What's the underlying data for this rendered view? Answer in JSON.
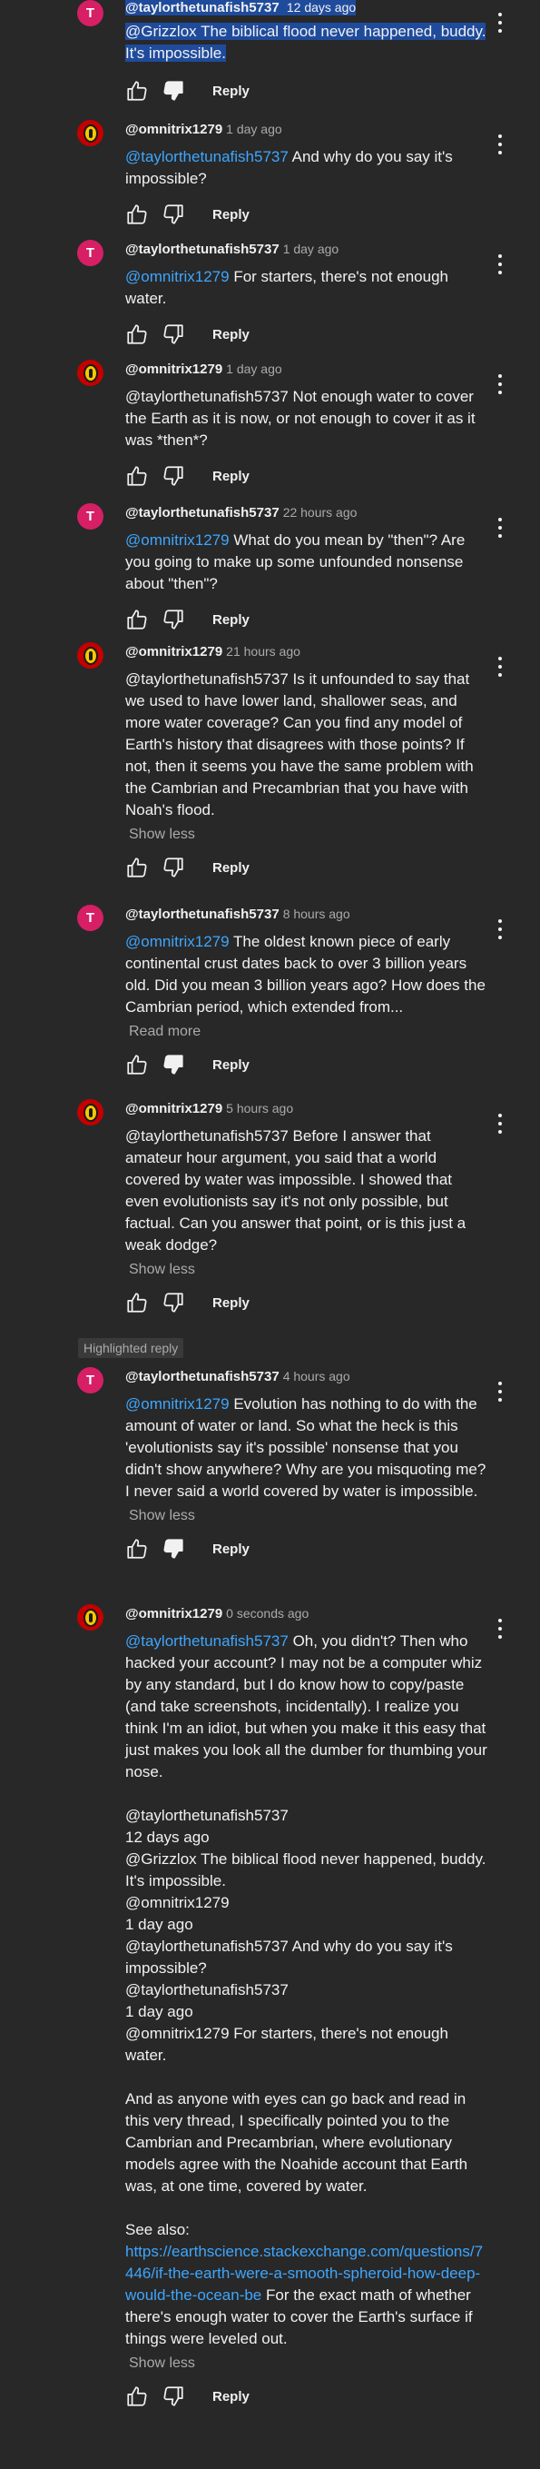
{
  "ui": {
    "reply_label": "Reply",
    "show_less": "Show less",
    "read_more": "Read more",
    "highlighted_reply": "Highlighted reply"
  },
  "comments": [
    {
      "author": "@taylorthetunafish5737",
      "time": "12 days ago",
      "avatar_letter": "T",
      "text": "@Grizzlox The biblical flood never happened, buddy. It's impossible."
    },
    {
      "author": "@omnitrix1279",
      "time": "1 day ago",
      "mention": "@taylorthetunafish5737",
      "text": "And why do you say it's impossible?"
    },
    {
      "author": "@taylorthetunafish5737",
      "time": "1 day ago",
      "avatar_letter": "T",
      "mention": "@omnitrix1279",
      "text": "For starters, there's not enough water."
    },
    {
      "author": "@omnitrix1279",
      "time": "1 day ago",
      "text": "@taylorthetunafish5737  Not enough water to cover the Earth as it is now, or not enough to cover it as it was *then*?"
    },
    {
      "author": "@taylorthetunafish5737",
      "time": "22 hours ago",
      "avatar_letter": "T",
      "mention": "@omnitrix1279",
      "text": "What do you mean by \"then\"? Are you going to make up some unfounded nonsense about \"then\"?"
    },
    {
      "author": "@omnitrix1279",
      "time": "21 hours ago",
      "text": "@taylorthetunafish5737  Is it unfounded to say that we used to have lower land, shallower seas, and more water coverage? Can you find any model of Earth's history that disagrees with those points? If not, then it seems you have the same problem with the Cambrian and Precambrian that you have with Noah's flood."
    },
    {
      "author": "@taylorthetunafish5737",
      "time": "8 hours ago",
      "avatar_letter": "T",
      "mention": "@omnitrix1279",
      "text": "The oldest known piece of early continental crust dates back to over 3 billion years old. Did you mean 3 billion years ago? How does the Cambrian period, which extended from..."
    },
    {
      "author": "@omnitrix1279",
      "time": "5 hours ago",
      "text": "@taylorthetunafish5737  Before I answer that amateur hour argument, you said that a world covered by water was impossible. I showed that even evolutionists say it's not only possible, but factual. Can you answer that point, or is this just a weak dodge?"
    },
    {
      "author": "@taylorthetunafish5737",
      "time": "4 hours ago",
      "avatar_letter": "T",
      "mention": "@omnitrix1279",
      "text": "Evolution has nothing to do with the amount of water or land. So what the heck is this 'evolutionists say it's possible'  nonsense that you didn't show anywhere? Why are you misquoting me? I never said a world covered by water is impossible."
    },
    {
      "author": "@omnitrix1279",
      "time": "0 seconds ago",
      "mention": "@taylorthetunafish5737",
      "text": "Oh, you didn't? Then who hacked your account? I may not be a computer whiz by any standard, but I do know how to copy/paste (and take screenshots, incidentally). I realize you think I'm an idiot, but when you make it this easy that just makes you look all the dumber for thumbing your nose.\n\n@taylorthetunafish5737\n12 days ago\n@Grizzlox The biblical flood never happened, buddy. It's impossible.\n@omnitrix1279\n 1 day ago\n @taylorthetunafish5737  And why do you say it's impossible?\n@taylorthetunafish5737\n1 day ago\n @omnitrix1279  For starters, there's not enough water.\n\nAnd as anyone with eyes can go back and read in this very thread, I specifically pointed you to the Cambrian and Precambrian, where evolutionary models agree with the Noahide account that Earth was, at one time, covered by water.\n\nSee also:",
      "link": "https://earthscience.stackexchange.com/questions/7446/if-the-earth-were-a-smooth-spheroid-how-deep-would-the-ocean-be",
      "after_link": " For the exact math of whether there's enough water to cover the Earth's surface if things were leveled out."
    }
  ]
}
